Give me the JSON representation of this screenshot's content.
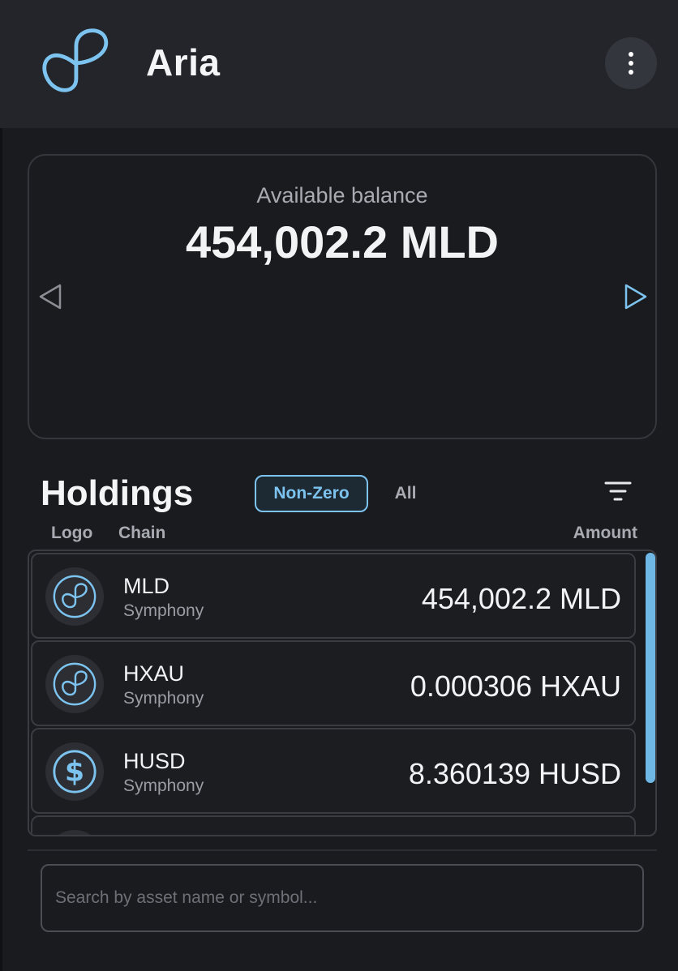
{
  "app": {
    "title": "Aria",
    "accent_color": "#7cc3ef",
    "logo_icon": "infinity-loop-logo"
  },
  "header": {
    "menu_icon": "vertical-dots-icon"
  },
  "balance": {
    "label": "Available balance",
    "value": "454,002.2 MLD",
    "prev_icon": "triangle-left-icon",
    "next_icon": "triangle-right-icon"
  },
  "holdings": {
    "title": "Holdings",
    "filters": [
      {
        "label": "Non-Zero",
        "active": true
      },
      {
        "label": "All",
        "active": false
      }
    ],
    "sort_icon": "filter-lines-icon",
    "columns": {
      "logo": "Logo",
      "chain": "Chain",
      "amount": "Amount"
    },
    "items": [
      {
        "symbol": "MLD",
        "chain": "Symphony",
        "amount": "454,002.2 MLD",
        "icon": "symphony-loop-icon"
      },
      {
        "symbol": "HXAU",
        "chain": "Symphony",
        "amount": "0.000306 HXAU",
        "icon": "symphony-loop-icon"
      },
      {
        "symbol": "HUSD",
        "chain": "Symphony",
        "amount": "8.360139 HUSD",
        "icon": "dollar-icon"
      }
    ]
  },
  "search": {
    "placeholder": "Search by asset name or symbol...",
    "value": ""
  }
}
